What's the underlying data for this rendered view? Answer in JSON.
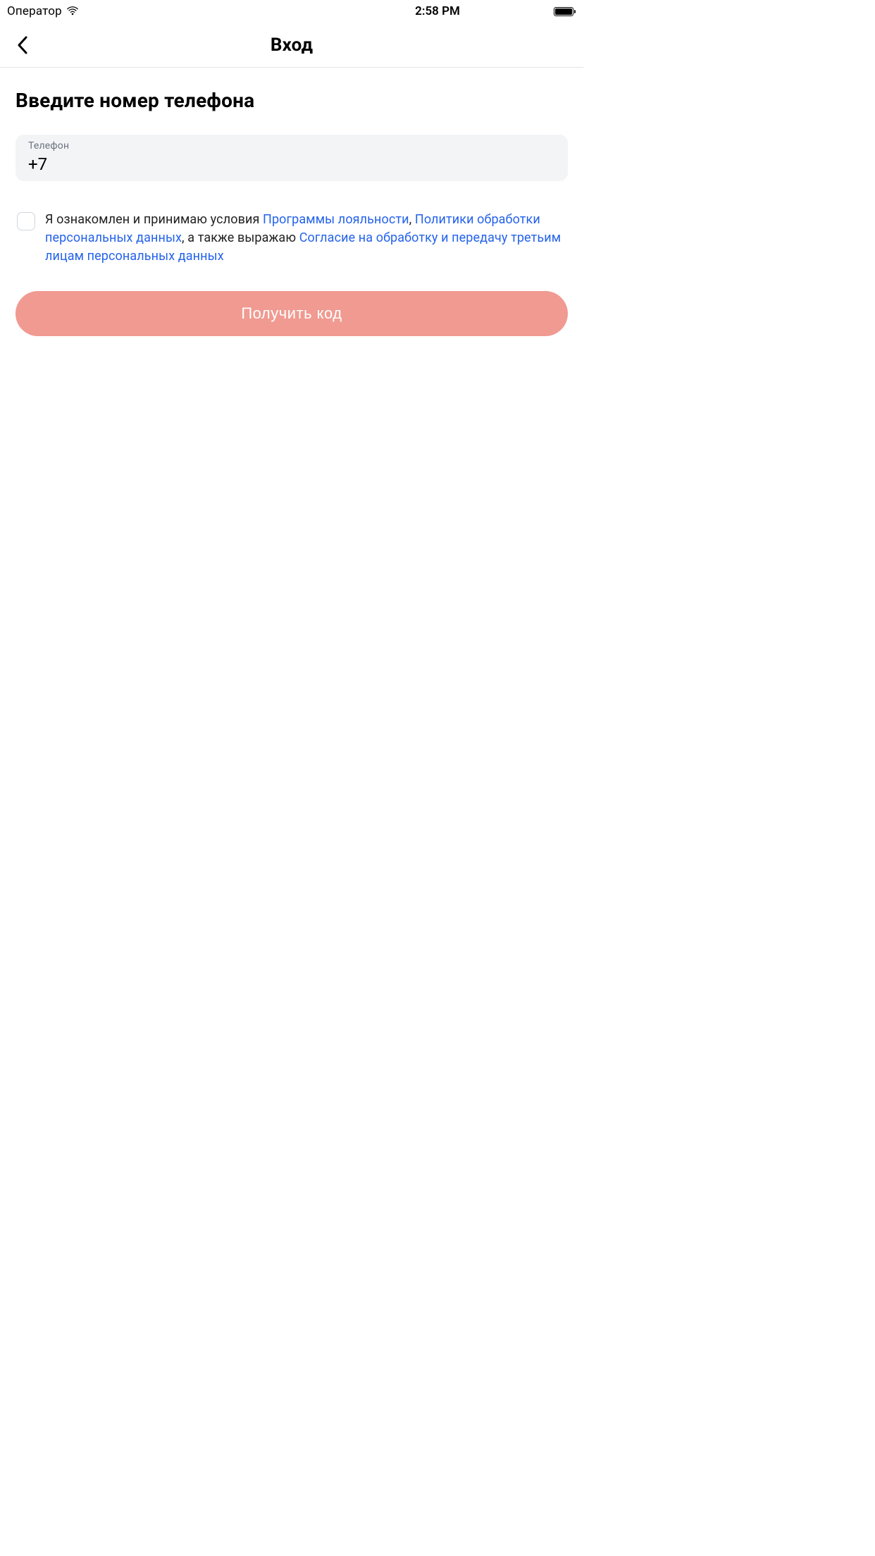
{
  "status": {
    "carrier": "Оператор",
    "time": "2:58 PM"
  },
  "nav": {
    "title": "Вход"
  },
  "heading": "Введите номер телефона",
  "phone": {
    "label": "Телефон",
    "value": "+7"
  },
  "consent": {
    "prefix1": "Я ознакомлен и принимаю условия ",
    "link1": "Программы лояльности",
    "sep1": ", ",
    "link2": "Политики обработки персональных данных",
    "sep2": ", а также выражаю ",
    "link3": "Согласие на обработку и передачу третьим лицам персональных данных"
  },
  "cta": "Получить код"
}
